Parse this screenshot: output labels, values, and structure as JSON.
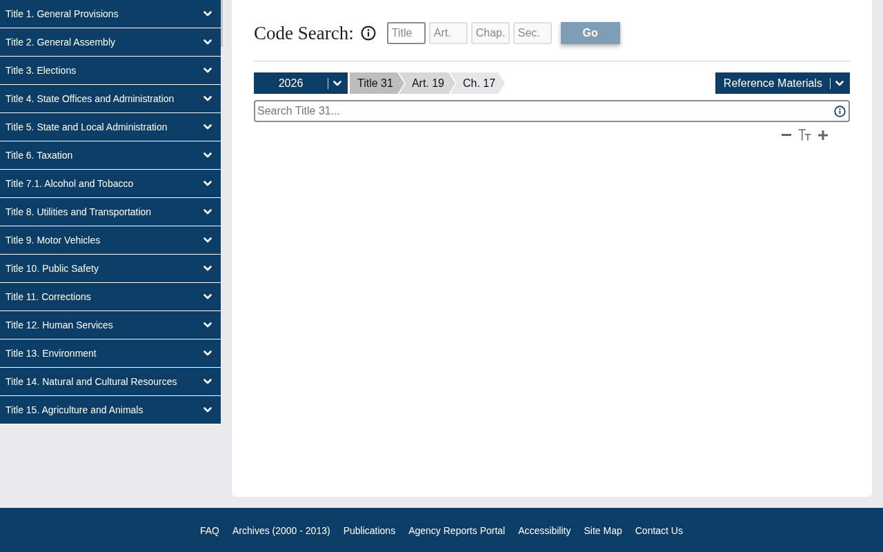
{
  "sidebar": {
    "items": [
      {
        "label": "Title 1. General Provisions",
        "expanded": false
      },
      {
        "label": "Title 2. General Assembly",
        "expanded": false
      },
      {
        "label": "Title 3. Elections",
        "expanded": false
      },
      {
        "label": "Title 4. State Offices and Administration",
        "expanded": false
      },
      {
        "label": "Title 5. State and Local Administration",
        "expanded": false
      },
      {
        "label": "Title 6. Taxation",
        "expanded": false
      },
      {
        "label": "Title 7.1. Alcohol and Tobacco",
        "expanded": false
      },
      {
        "label": "Title 8. Utilities and Transportation",
        "expanded": false
      },
      {
        "label": "Title 9. Motor Vehicles",
        "expanded": false
      },
      {
        "label": "Title 10. Public Safety",
        "expanded": false
      },
      {
        "label": "Title 11. Corrections",
        "expanded": false
      },
      {
        "label": "Title 12. Human Services",
        "expanded": false
      },
      {
        "label": "Title 13. Environment",
        "expanded": false
      },
      {
        "label": "Title 14. Natural and Cultural Resources",
        "expanded": false
      },
      {
        "label": "Title 15. Agriculture and Animals",
        "expanded": false
      }
    ]
  },
  "code_search": {
    "title": "Code Search:",
    "fields": [
      {
        "placeholder": "Title",
        "disabled": false
      },
      {
        "placeholder": "Art.",
        "disabled": true
      },
      {
        "placeholder": "Chap.",
        "disabled": true
      },
      {
        "placeholder": "Sec.",
        "disabled": true
      }
    ],
    "button": "Go"
  },
  "toolbar": {
    "year": "2026",
    "breadcrumbs": [
      "Title 31",
      "Art. 19",
      "Ch. 17"
    ],
    "reference_button": "Reference Materials"
  },
  "search": {
    "placeholder": "Search Title 31..."
  },
  "footer": {
    "links": [
      "FAQ",
      "Archives (2000 - 2013)",
      "Publications",
      "Agency Reports Portal",
      "Accessibility",
      "Site Map",
      "Contact Us"
    ]
  }
}
